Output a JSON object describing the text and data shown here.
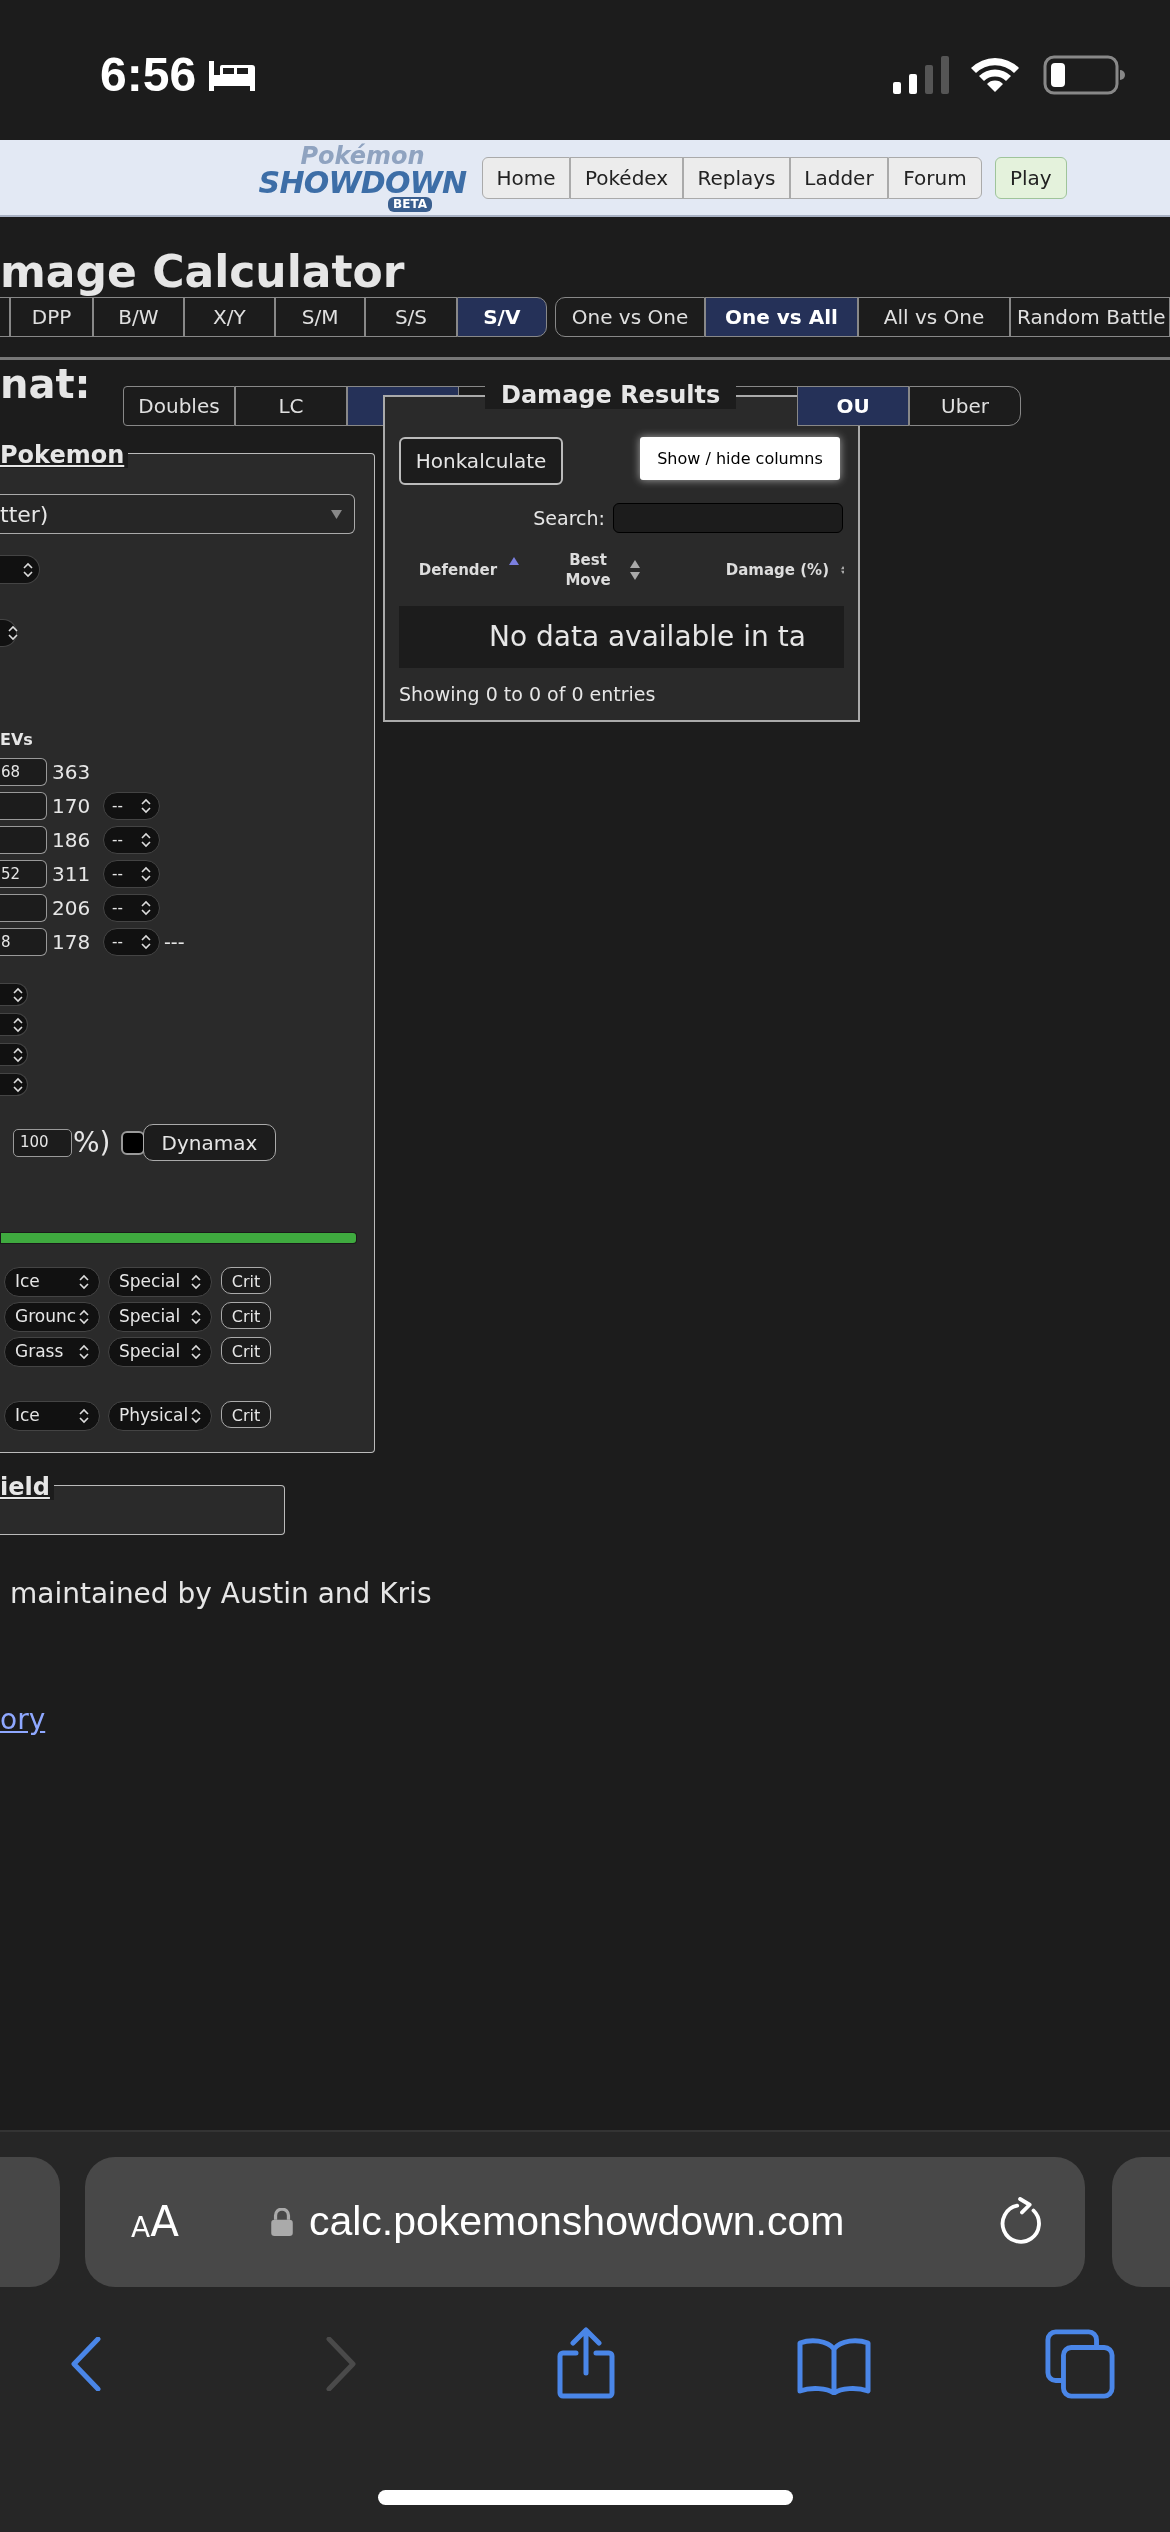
{
  "status_bar": {
    "time": "6:56"
  },
  "site_header": {
    "logo": {
      "top": "Pokémon",
      "main": "SHOWDOWN",
      "badge": "BETA"
    },
    "nav": [
      {
        "label": "Home",
        "kind": "link"
      },
      {
        "label": "Pokédex",
        "kind": "link"
      },
      {
        "label": "Replays",
        "kind": "link"
      },
      {
        "label": "Ladder",
        "kind": "link"
      },
      {
        "label": "Forum",
        "kind": "link"
      },
      {
        "label": "Play",
        "kind": "play"
      }
    ]
  },
  "page_title": "mage Calculator",
  "gen_tabs": [
    {
      "label": "DPP",
      "selected": false
    },
    {
      "label": "B/W",
      "selected": false
    },
    {
      "label": "X/Y",
      "selected": false
    },
    {
      "label": "S/M",
      "selected": false
    },
    {
      "label": "S/S",
      "selected": false
    },
    {
      "label": "S/V",
      "selected": true
    }
  ],
  "mode_tabs": [
    {
      "label": "One vs One",
      "selected": false
    },
    {
      "label": "One vs All",
      "selected": true
    },
    {
      "label": "All vs One",
      "selected": false
    },
    {
      "label": "Random Battle",
      "selected": false
    }
  ],
  "format": {
    "label": "nat:",
    "tabs_left": [
      {
        "label": "Doubles",
        "selected": false
      },
      {
        "label": "LC",
        "selected": false
      },
      {
        "selected": true
      }
    ],
    "tabs_right": [
      {
        "label": "OU",
        "selected": true
      },
      {
        "label": "Uber",
        "selected": false
      }
    ]
  },
  "damage_results": {
    "title": "Damage Results",
    "calc_button": "Honkalculate",
    "columns_button": "Show / hide columns",
    "search_label": "Search:",
    "columns": [
      {
        "label": "Defender",
        "sorted": true
      },
      {
        "label": "Best Move",
        "sorted": false
      },
      {
        "label": "Damage (%)",
        "sorted": false
      }
    ],
    "empty_message": "No data available in ta",
    "info": "Showing 0 to 0 of 0 entries"
  },
  "pokemon_panel": {
    "legend": "Pokemon",
    "species": "tter)",
    "evs_header": "EVs",
    "stats": [
      {
        "ev": "68",
        "total": "363"
      },
      {
        "total": "170",
        "boost": "--"
      },
      {
        "total": "186",
        "boost": "--"
      },
      {
        "ev": "52",
        "total": "311",
        "boost": "--"
      },
      {
        "total": "206",
        "boost": "--"
      },
      {
        "ev": "8",
        "total": "178",
        "boost": "--",
        "note": "---"
      }
    ],
    "hp_percent": "100",
    "percent_suffix": "%)",
    "dynamax": {
      "label": "Dynamax",
      "checked": false
    },
    "hp_bar": {
      "level": 1
    },
    "moves": [
      {
        "type": "Ice",
        "category": "Special",
        "crit": {
          "label": "Crit",
          "selected": false
        }
      },
      {
        "type": "Grounc",
        "category": "Special",
        "crit": {
          "label": "Crit",
          "selected": false
        }
      },
      {
        "type": "Grass",
        "category": "Special",
        "crit": {
          "label": "Crit",
          "selected": false
        }
      },
      {
        "type": "Ice",
        "category": "Physical",
        "crit": {
          "label": "Crit",
          "selected": false
        }
      }
    ]
  },
  "field": {
    "legend": "ield"
  },
  "credit": "maintained by Austin and Kris",
  "link": "ory",
  "browser": {
    "text_size": "AA",
    "url": "calc.pokemonshowdown.com"
  }
}
